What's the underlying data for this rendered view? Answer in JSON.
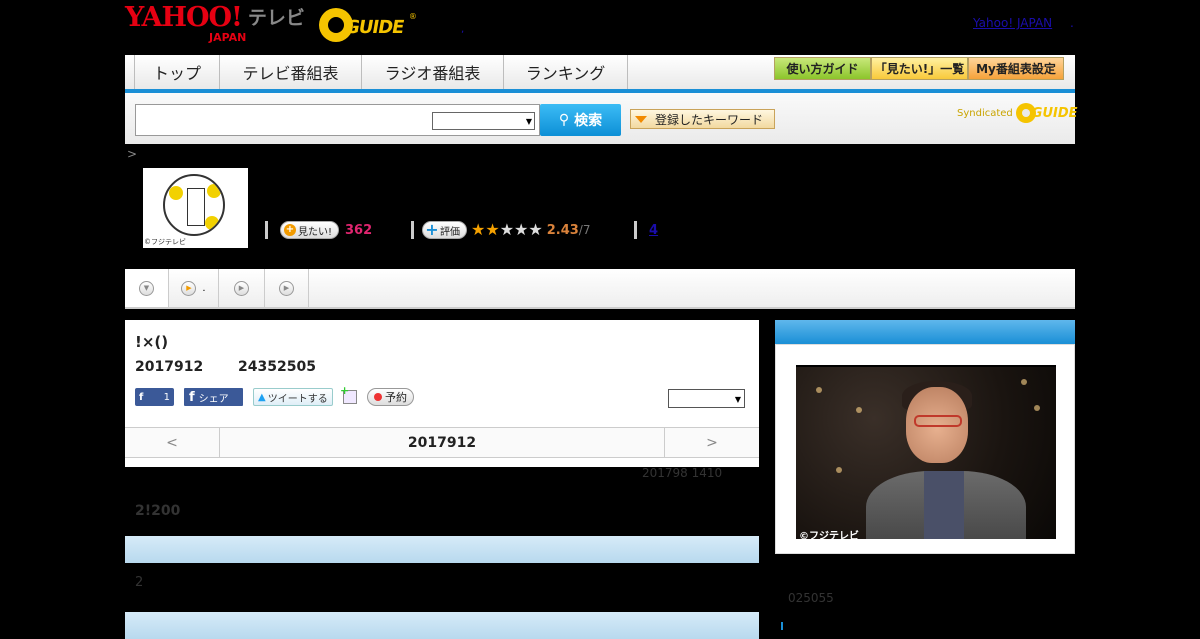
{
  "header": {
    "yahoo_logo": "YAHOO!",
    "japan_sub": "JAPAN",
    "tv_label": "テレビ",
    "gguide_logo": "GUIDE",
    "gguide_reg": "®",
    "dot": ",",
    "yahoo_japan_link": "Yahoo! JAPAN",
    "trailing_dot": "."
  },
  "nav": {
    "tabs": [
      "トップ",
      "テレビ番組表",
      "ラジオ番組表",
      "ランキング"
    ],
    "guide_button": "使い方ガイド",
    "watchlist_button": "「見たい!」一覧",
    "my_schedule_button": "My番組表設定"
  },
  "search": {
    "query": "",
    "search_button": "検索",
    "keyword_button": "登録したキーワード",
    "syndicated_label": "Syndicated",
    "syndicated_guide": "GUIDE"
  },
  "breadcrumb": ">",
  "program": {
    "thumb_copyright": "©フジテレビ",
    "want_label": "見たい!",
    "want_count": "362",
    "rate_label": "評価",
    "rating": "2.43",
    "rating_of": "/7",
    "rating_stars": 2,
    "review_count": "4"
  },
  "tabs": {
    "tab2_suffix": "."
  },
  "detail": {
    "title": "!×()",
    "date": "2017912",
    "time": "24352505",
    "fb_like_count": "1",
    "fb_share_label": "シェア",
    "tweet_label": "ツイートする",
    "reserve_label": "予約",
    "pager_prev": "<",
    "pager_date": "2017912",
    "pager_next": ">",
    "updated": "201798  1410",
    "stat_line": "2!200",
    "section_text": "2"
  },
  "sidebar": {
    "photo_copyright": "©フジテレビ",
    "caption": "025055"
  }
}
